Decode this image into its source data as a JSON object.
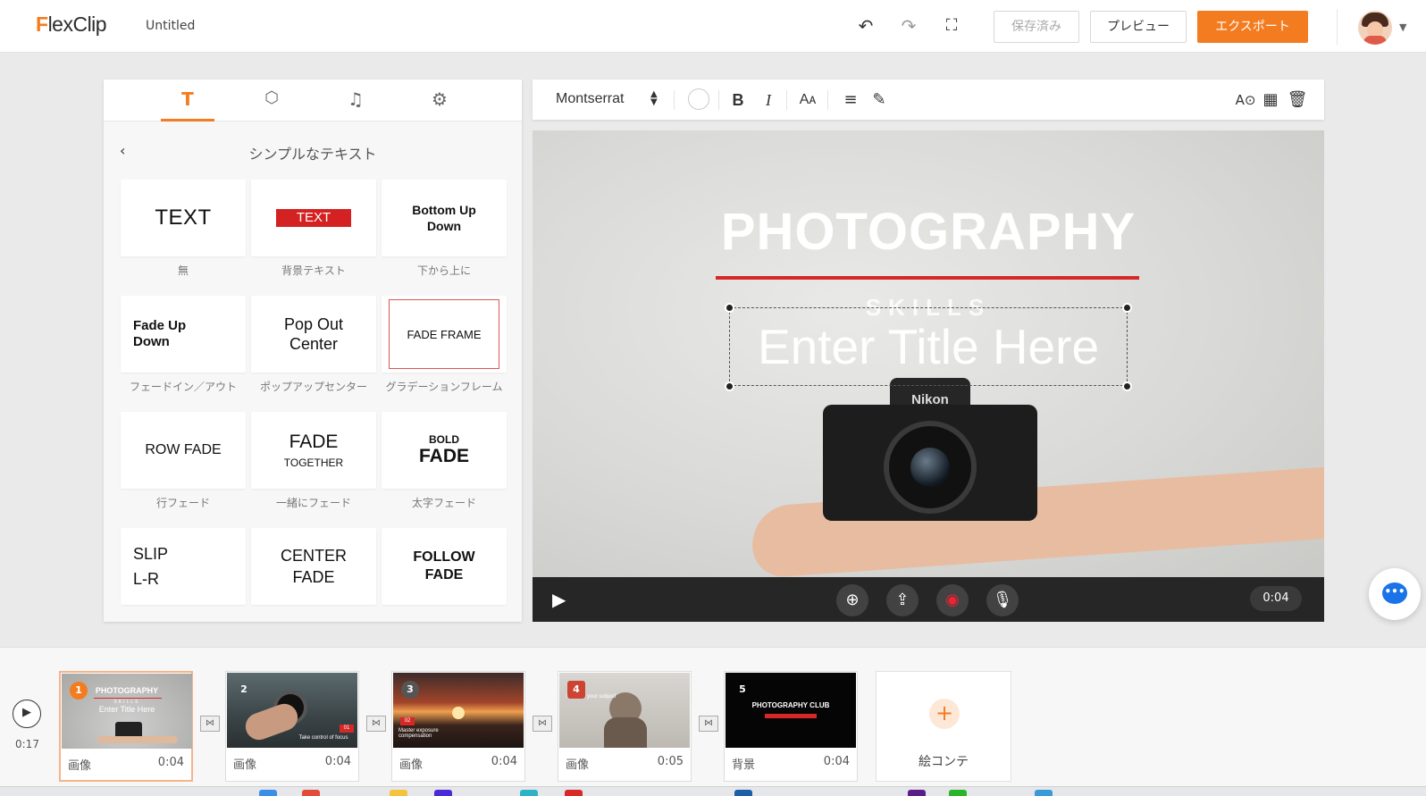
{
  "header": {
    "logo": "FlexClip",
    "title": "Untitled",
    "saved_label": "保存済み",
    "preview_label": "プレビュー",
    "export_label": "エクスポート"
  },
  "colors": {
    "accent": "#f47c20",
    "title_line": "#d62828",
    "text_bg": "#d42121"
  },
  "panel": {
    "tabs": [
      {
        "name": "text",
        "icon": "text-icon"
      },
      {
        "name": "elements",
        "icon": "elements-icon"
      },
      {
        "name": "music",
        "icon": "music-icon"
      },
      {
        "name": "settings",
        "icon": "settings-icon"
      }
    ],
    "section_title": "シンプルなテキスト",
    "presets": [
      {
        "preview": "TEXT",
        "caption": "無"
      },
      {
        "preview": "TEXT",
        "caption": "背景テキスト"
      },
      {
        "preview": "Bottom Up Down",
        "caption": "下から上に"
      },
      {
        "preview": "Fade Up Down",
        "caption": "フェードイン／アウト"
      },
      {
        "preview": "Pop Out Center",
        "caption": "ポップアップセンター"
      },
      {
        "preview": "FADE FRAME",
        "caption": "グラデーションフレーム"
      },
      {
        "preview": "ROW FADE",
        "caption": "行フェード"
      },
      {
        "preview": "FADE",
        "preview_sub": "TOGETHER",
        "caption": "一緒にフェード"
      },
      {
        "preview_top": "BOLD",
        "preview": "FADE",
        "caption": "太字フェード"
      },
      {
        "preview": "SLIP L-R",
        "caption": ""
      },
      {
        "preview": "CENTER FADE",
        "caption": ""
      },
      {
        "preview": "FOLLOW FADE",
        "caption": ""
      }
    ]
  },
  "toolbar": {
    "font": "Montserrat"
  },
  "canvas": {
    "title": "PHOTOGRAPHY",
    "subtitle": "SKILLS",
    "textbox": "Enter Title Here",
    "camera_brand": "Nikon"
  },
  "player": {
    "time": "0:04"
  },
  "timeline": {
    "total": "0:17",
    "clips": [
      {
        "num": "1",
        "type": "画像",
        "duration": "0:04",
        "thumb_title": "PHOTOGRAPHY",
        "thumb_sub": "SKILLS",
        "thumb_text": "Enter Title Here"
      },
      {
        "num": "2",
        "type": "画像",
        "duration": "0:04",
        "thumb_badge": "01",
        "thumb_text": "Take control of focus"
      },
      {
        "num": "3",
        "type": "画像",
        "duration": "0:04",
        "thumb_badge": "02",
        "thumb_text": "Master exposure compensation"
      },
      {
        "num": "4",
        "type": "画像",
        "duration": "0:05",
        "thumb_text": "Position your subject"
      },
      {
        "num": "5",
        "type": "背景",
        "duration": "0:04",
        "thumb_title": "PHOTOGRAPHY CLUB"
      }
    ],
    "add_label": "絵コンテ"
  }
}
